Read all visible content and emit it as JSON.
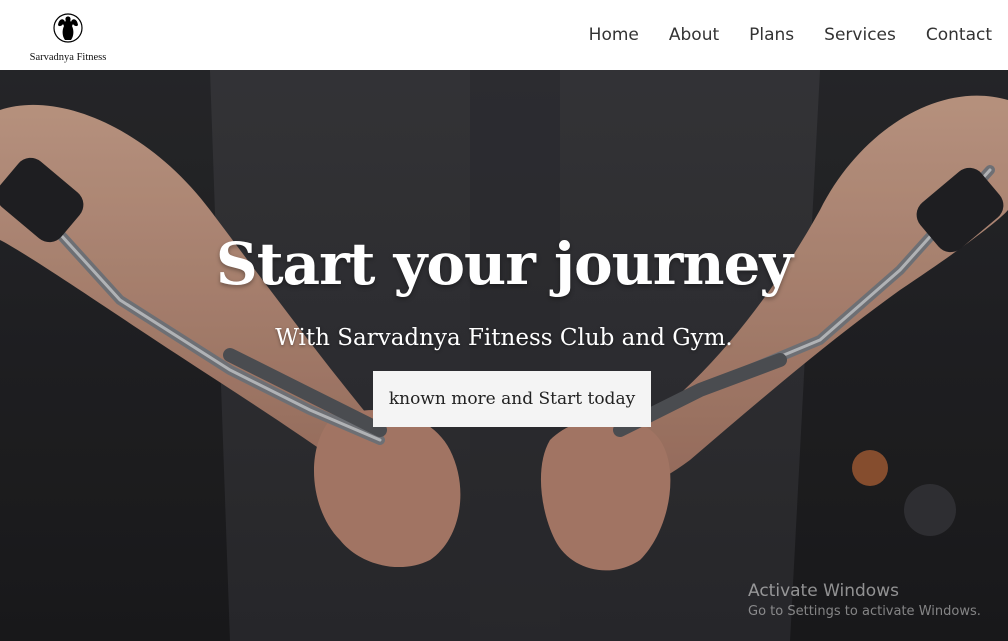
{
  "header": {
    "logo_text": "Sarvadnya Fitness",
    "logo_icon": "bodybuilder-icon",
    "nav": [
      {
        "label": "Home"
      },
      {
        "label": "About"
      },
      {
        "label": "Plans"
      },
      {
        "label": "Services"
      },
      {
        "label": "Contact"
      }
    ]
  },
  "hero": {
    "title": "Start your journey",
    "subtitle": "With Sarvadnya Fitness Club and Gym.",
    "cta_label": "known more and Start today"
  },
  "watermark": {
    "title": "Activate Windows",
    "subtitle": "Go to Settings to activate Windows."
  },
  "colors": {
    "header_bg": "#ffffff",
    "nav_text": "#333333",
    "hero_text": "#ffffff",
    "cta_bg": "#f4f4f4"
  }
}
